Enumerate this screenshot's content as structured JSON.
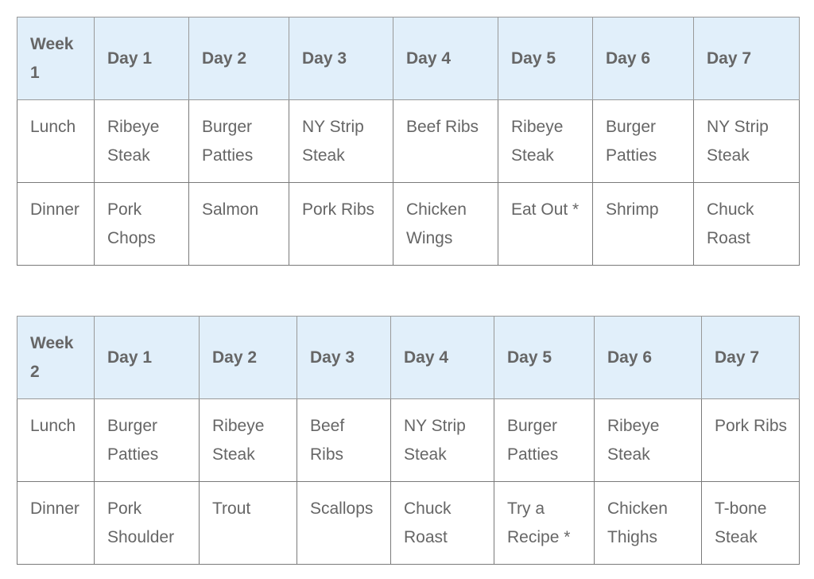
{
  "tables": [
    {
      "header": [
        "Week 1",
        "Day 1",
        "Day 2",
        "Day 3",
        "Day 4",
        "Day 5",
        "Day 6",
        "Day 7"
      ],
      "rows": [
        [
          "Lunch",
          "Ribeye Steak",
          "Burger Patties",
          "NY Strip Steak",
          "Beef Ribs",
          "Ribeye Steak",
          "Burger Patties",
          "NY Strip Steak"
        ],
        [
          "Dinner",
          "Pork Chops",
          "Salmon",
          "Pork Ribs",
          "Chicken Wings",
          "Eat Out *",
          "Shrimp",
          "Chuck Roast"
        ]
      ]
    },
    {
      "header": [
        "Week 2",
        "Day 1",
        "Day 2",
        "Day 3",
        "Day 4",
        "Day 5",
        "Day 6",
        "Day 7"
      ],
      "rows": [
        [
          "Lunch",
          "Burger Patties",
          "Ribeye Steak",
          "Beef Ribs",
          "NY Strip Steak",
          "Burger Patties",
          "Ribeye Steak",
          "Pork Ribs"
        ],
        [
          "Dinner",
          "Pork Shoulder",
          "Trout",
          "Scallops",
          "Chuck Roast",
          "Try a Recipe *",
          "Chicken Thighs",
          "T-bone Steak"
        ]
      ]
    }
  ],
  "colors": {
    "header_bg": "#e1effa",
    "text": "#666666",
    "border": "#7a7a7a"
  }
}
